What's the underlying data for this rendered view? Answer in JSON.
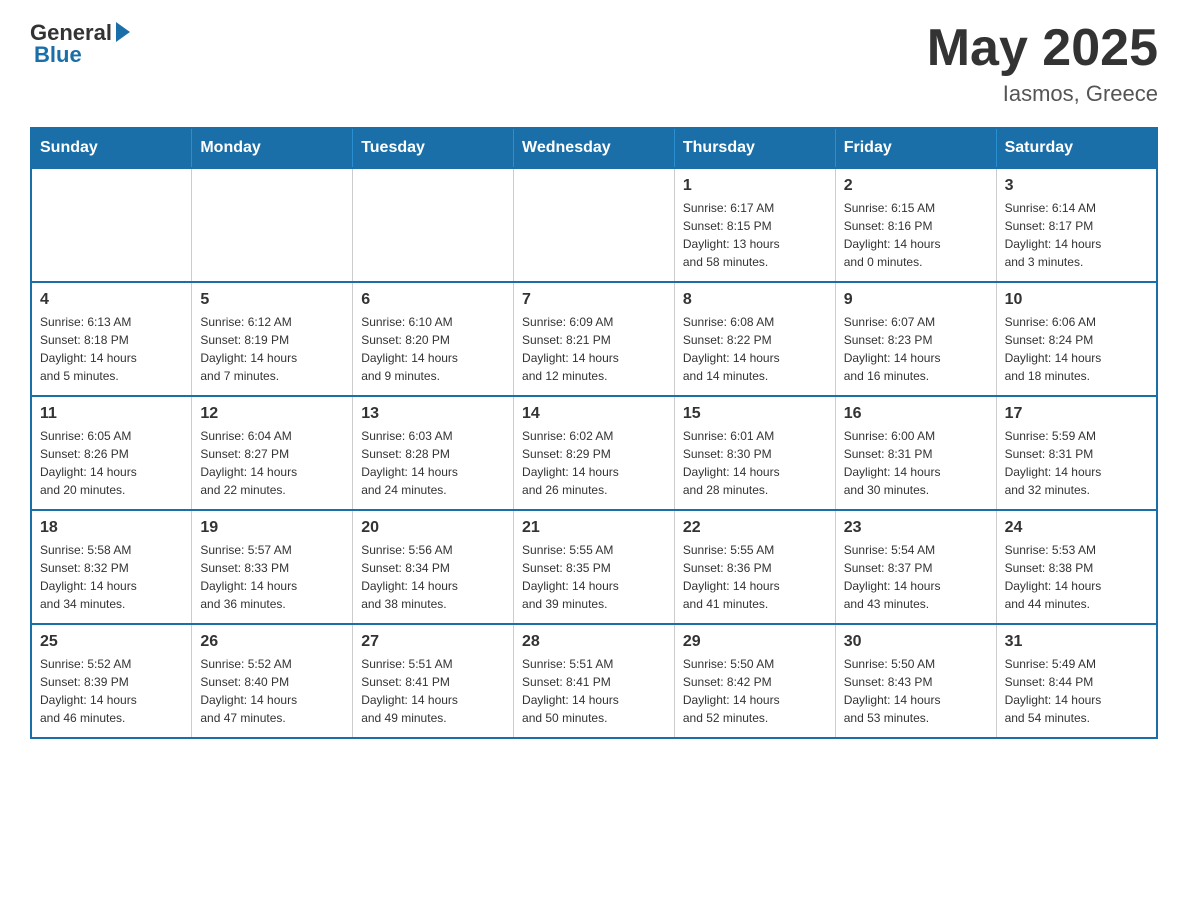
{
  "header": {
    "logo_general": "General",
    "logo_blue": "Blue",
    "month_title": "May 2025",
    "location": "Iasmos, Greece"
  },
  "weekdays": [
    "Sunday",
    "Monday",
    "Tuesday",
    "Wednesday",
    "Thursday",
    "Friday",
    "Saturday"
  ],
  "weeks": [
    [
      {
        "day": "",
        "info": ""
      },
      {
        "day": "",
        "info": ""
      },
      {
        "day": "",
        "info": ""
      },
      {
        "day": "",
        "info": ""
      },
      {
        "day": "1",
        "info": "Sunrise: 6:17 AM\nSunset: 8:15 PM\nDaylight: 13 hours\nand 58 minutes."
      },
      {
        "day": "2",
        "info": "Sunrise: 6:15 AM\nSunset: 8:16 PM\nDaylight: 14 hours\nand 0 minutes."
      },
      {
        "day": "3",
        "info": "Sunrise: 6:14 AM\nSunset: 8:17 PM\nDaylight: 14 hours\nand 3 minutes."
      }
    ],
    [
      {
        "day": "4",
        "info": "Sunrise: 6:13 AM\nSunset: 8:18 PM\nDaylight: 14 hours\nand 5 minutes."
      },
      {
        "day": "5",
        "info": "Sunrise: 6:12 AM\nSunset: 8:19 PM\nDaylight: 14 hours\nand 7 minutes."
      },
      {
        "day": "6",
        "info": "Sunrise: 6:10 AM\nSunset: 8:20 PM\nDaylight: 14 hours\nand 9 minutes."
      },
      {
        "day": "7",
        "info": "Sunrise: 6:09 AM\nSunset: 8:21 PM\nDaylight: 14 hours\nand 12 minutes."
      },
      {
        "day": "8",
        "info": "Sunrise: 6:08 AM\nSunset: 8:22 PM\nDaylight: 14 hours\nand 14 minutes."
      },
      {
        "day": "9",
        "info": "Sunrise: 6:07 AM\nSunset: 8:23 PM\nDaylight: 14 hours\nand 16 minutes."
      },
      {
        "day": "10",
        "info": "Sunrise: 6:06 AM\nSunset: 8:24 PM\nDaylight: 14 hours\nand 18 minutes."
      }
    ],
    [
      {
        "day": "11",
        "info": "Sunrise: 6:05 AM\nSunset: 8:26 PM\nDaylight: 14 hours\nand 20 minutes."
      },
      {
        "day": "12",
        "info": "Sunrise: 6:04 AM\nSunset: 8:27 PM\nDaylight: 14 hours\nand 22 minutes."
      },
      {
        "day": "13",
        "info": "Sunrise: 6:03 AM\nSunset: 8:28 PM\nDaylight: 14 hours\nand 24 minutes."
      },
      {
        "day": "14",
        "info": "Sunrise: 6:02 AM\nSunset: 8:29 PM\nDaylight: 14 hours\nand 26 minutes."
      },
      {
        "day": "15",
        "info": "Sunrise: 6:01 AM\nSunset: 8:30 PM\nDaylight: 14 hours\nand 28 minutes."
      },
      {
        "day": "16",
        "info": "Sunrise: 6:00 AM\nSunset: 8:31 PM\nDaylight: 14 hours\nand 30 minutes."
      },
      {
        "day": "17",
        "info": "Sunrise: 5:59 AM\nSunset: 8:31 PM\nDaylight: 14 hours\nand 32 minutes."
      }
    ],
    [
      {
        "day": "18",
        "info": "Sunrise: 5:58 AM\nSunset: 8:32 PM\nDaylight: 14 hours\nand 34 minutes."
      },
      {
        "day": "19",
        "info": "Sunrise: 5:57 AM\nSunset: 8:33 PM\nDaylight: 14 hours\nand 36 minutes."
      },
      {
        "day": "20",
        "info": "Sunrise: 5:56 AM\nSunset: 8:34 PM\nDaylight: 14 hours\nand 38 minutes."
      },
      {
        "day": "21",
        "info": "Sunrise: 5:55 AM\nSunset: 8:35 PM\nDaylight: 14 hours\nand 39 minutes."
      },
      {
        "day": "22",
        "info": "Sunrise: 5:55 AM\nSunset: 8:36 PM\nDaylight: 14 hours\nand 41 minutes."
      },
      {
        "day": "23",
        "info": "Sunrise: 5:54 AM\nSunset: 8:37 PM\nDaylight: 14 hours\nand 43 minutes."
      },
      {
        "day": "24",
        "info": "Sunrise: 5:53 AM\nSunset: 8:38 PM\nDaylight: 14 hours\nand 44 minutes."
      }
    ],
    [
      {
        "day": "25",
        "info": "Sunrise: 5:52 AM\nSunset: 8:39 PM\nDaylight: 14 hours\nand 46 minutes."
      },
      {
        "day": "26",
        "info": "Sunrise: 5:52 AM\nSunset: 8:40 PM\nDaylight: 14 hours\nand 47 minutes."
      },
      {
        "day": "27",
        "info": "Sunrise: 5:51 AM\nSunset: 8:41 PM\nDaylight: 14 hours\nand 49 minutes."
      },
      {
        "day": "28",
        "info": "Sunrise: 5:51 AM\nSunset: 8:41 PM\nDaylight: 14 hours\nand 50 minutes."
      },
      {
        "day": "29",
        "info": "Sunrise: 5:50 AM\nSunset: 8:42 PM\nDaylight: 14 hours\nand 52 minutes."
      },
      {
        "day": "30",
        "info": "Sunrise: 5:50 AM\nSunset: 8:43 PM\nDaylight: 14 hours\nand 53 minutes."
      },
      {
        "day": "31",
        "info": "Sunrise: 5:49 AM\nSunset: 8:44 PM\nDaylight: 14 hours\nand 54 minutes."
      }
    ]
  ]
}
